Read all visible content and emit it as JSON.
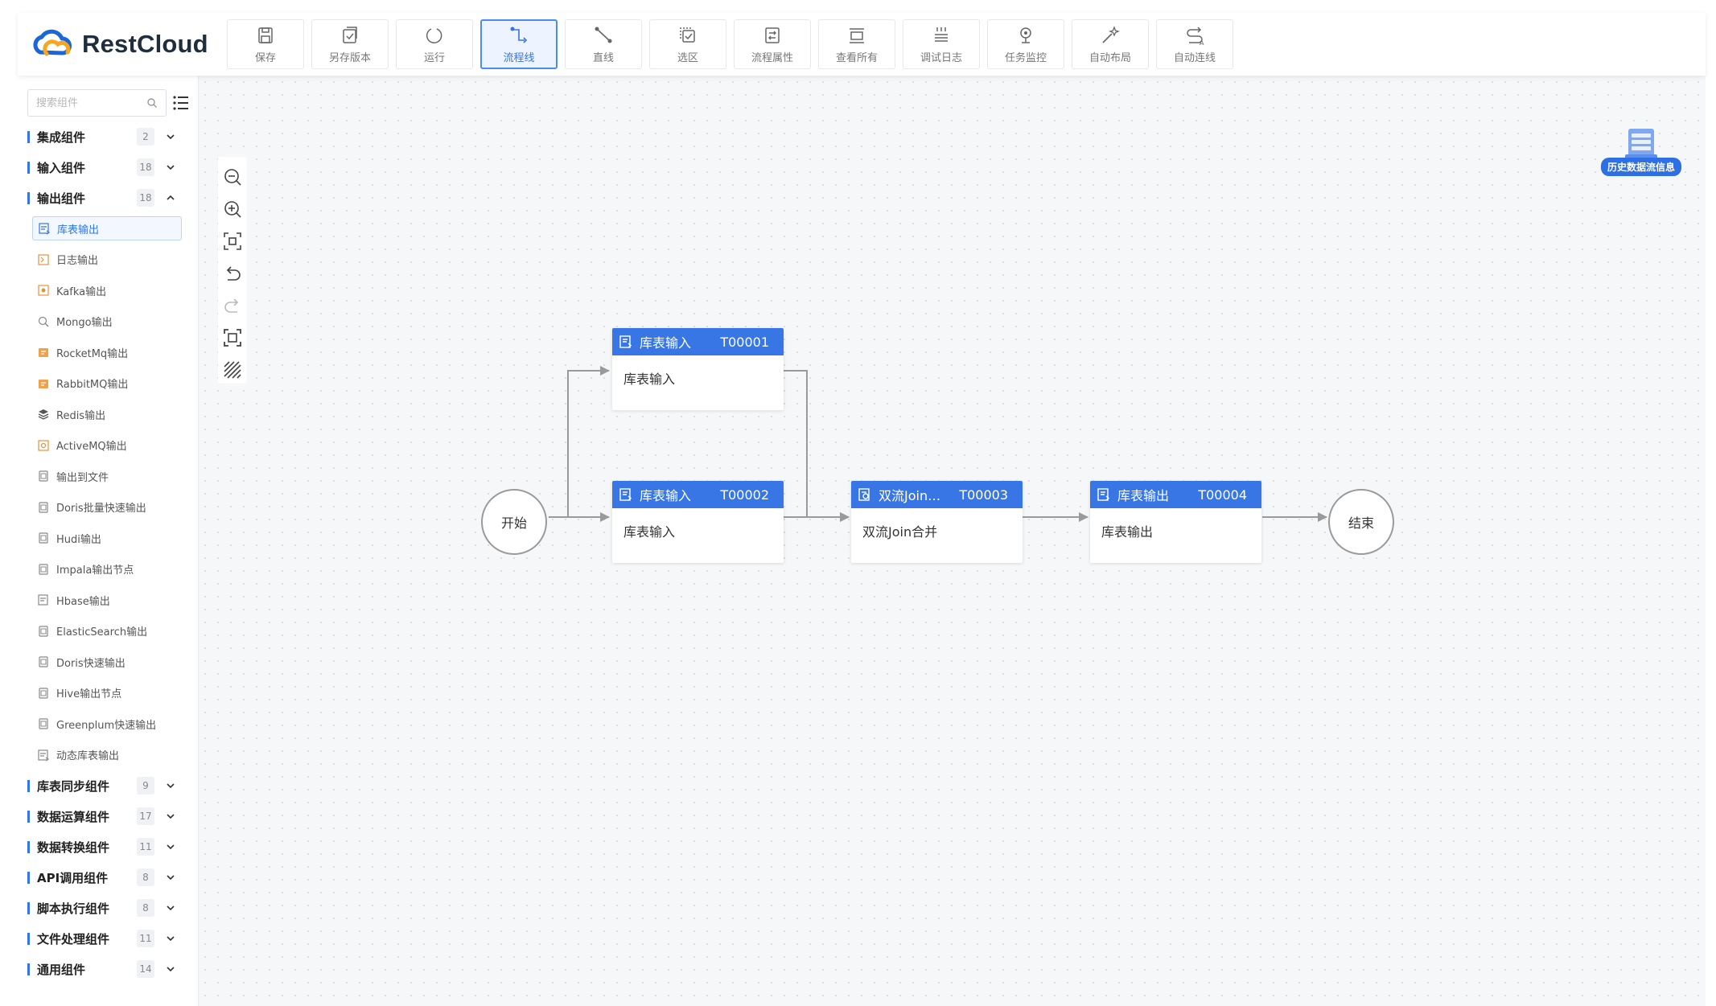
{
  "brand": {
    "name": "RestCloud",
    "logo_icon": "cloud-logo-icon"
  },
  "toolbar": [
    {
      "id": "save",
      "label": "保存",
      "icon": "save-icon"
    },
    {
      "id": "save-version",
      "label": "另存版本",
      "icon": "save-version-icon"
    },
    {
      "id": "run",
      "label": "运行",
      "icon": "run-icon"
    },
    {
      "id": "flowline",
      "label": "流程线",
      "icon": "flowline-icon",
      "active": true
    },
    {
      "id": "straight",
      "label": "直线",
      "icon": "straight-line-icon"
    },
    {
      "id": "select-area",
      "label": "选区",
      "icon": "select-area-icon"
    },
    {
      "id": "flow-props",
      "label": "流程属性",
      "icon": "flow-properties-icon"
    },
    {
      "id": "view-all",
      "label": "查看所有",
      "icon": "view-all-icon"
    },
    {
      "id": "debug-log",
      "label": "调试日志",
      "icon": "debug-log-icon"
    },
    {
      "id": "task-monitor",
      "label": "任务监控",
      "icon": "task-monitor-icon"
    },
    {
      "id": "auto-layout",
      "label": "自动布局",
      "icon": "auto-layout-icon"
    },
    {
      "id": "auto-connect",
      "label": "自动连线",
      "icon": "auto-connect-icon"
    }
  ],
  "sidebar": {
    "search": {
      "placeholder": "搜索组件",
      "value": ""
    },
    "groups_top": [
      {
        "label": "集成组件",
        "count": "2",
        "expanded": false
      },
      {
        "label": "输入组件",
        "count": "18",
        "expanded": false
      },
      {
        "label": "输出组件",
        "count": "18",
        "expanded": true
      }
    ],
    "items": [
      {
        "label": "库表输出",
        "icon": "table-output-icon",
        "selected": true
      },
      {
        "label": "日志输出",
        "icon": "log-output-icon"
      },
      {
        "label": "Kafka输出",
        "icon": "kafka-icon"
      },
      {
        "label": "Mongo输出",
        "icon": "mongo-icon"
      },
      {
        "label": "RocketMq输出",
        "icon": "rocketmq-icon"
      },
      {
        "label": "RabbitMQ输出",
        "icon": "rabbitmq-icon"
      },
      {
        "label": "Redis输出",
        "icon": "redis-icon"
      },
      {
        "label": "ActiveMQ输出",
        "icon": "activemq-icon"
      },
      {
        "label": "输出到文件",
        "icon": "file-output-icon"
      },
      {
        "label": "Doris批量快速输出",
        "icon": "doris-batch-icon"
      },
      {
        "label": "Hudi输出",
        "icon": "hudi-icon"
      },
      {
        "label": "Impala输出节点",
        "icon": "impala-icon"
      },
      {
        "label": "Hbase输出",
        "icon": "hbase-icon"
      },
      {
        "label": "ElasticSearch输出",
        "icon": "elasticsearch-icon"
      },
      {
        "label": "Doris快速输出",
        "icon": "doris-fast-icon"
      },
      {
        "label": "Hive输出节点",
        "icon": "hive-icon"
      },
      {
        "label": "Greenplum快速输出",
        "icon": "greenplum-icon"
      },
      {
        "label": "动态库表输出",
        "icon": "dynamic-table-icon"
      }
    ],
    "groups_bottom": [
      {
        "label": "库表同步组件",
        "count": "9"
      },
      {
        "label": "数据运算组件",
        "count": "17"
      },
      {
        "label": "数据转换组件",
        "count": "11"
      },
      {
        "label": "API调用组件",
        "count": "8"
      },
      {
        "label": "脚本执行组件",
        "count": "8"
      },
      {
        "label": "文件处理组件",
        "count": "11"
      },
      {
        "label": "通用组件",
        "count": "14"
      }
    ]
  },
  "canvas": {
    "zoom_controls": [
      "zoom-out-icon",
      "zoom-in-icon",
      "fit-center-icon",
      "undo-icon",
      "redo-icon",
      "fit-screen-icon",
      "grid-toggle-icon"
    ],
    "history_label": "历史数据流信息",
    "start_label": "开始",
    "end_label": "结束",
    "nodes": [
      {
        "title": "库表输入",
        "id": "T00001",
        "body": "库表输入"
      },
      {
        "title": "库表输入",
        "id": "T00002",
        "body": "库表输入"
      },
      {
        "title": "双流Join…",
        "id": "T00003",
        "body": "双流Join合并"
      },
      {
        "title": "库表输出",
        "id": "T00004",
        "body": "库表输出"
      }
    ]
  },
  "colors": {
    "accent": "#3474ec",
    "node_header": "#3876e6",
    "edge": "#999999"
  }
}
